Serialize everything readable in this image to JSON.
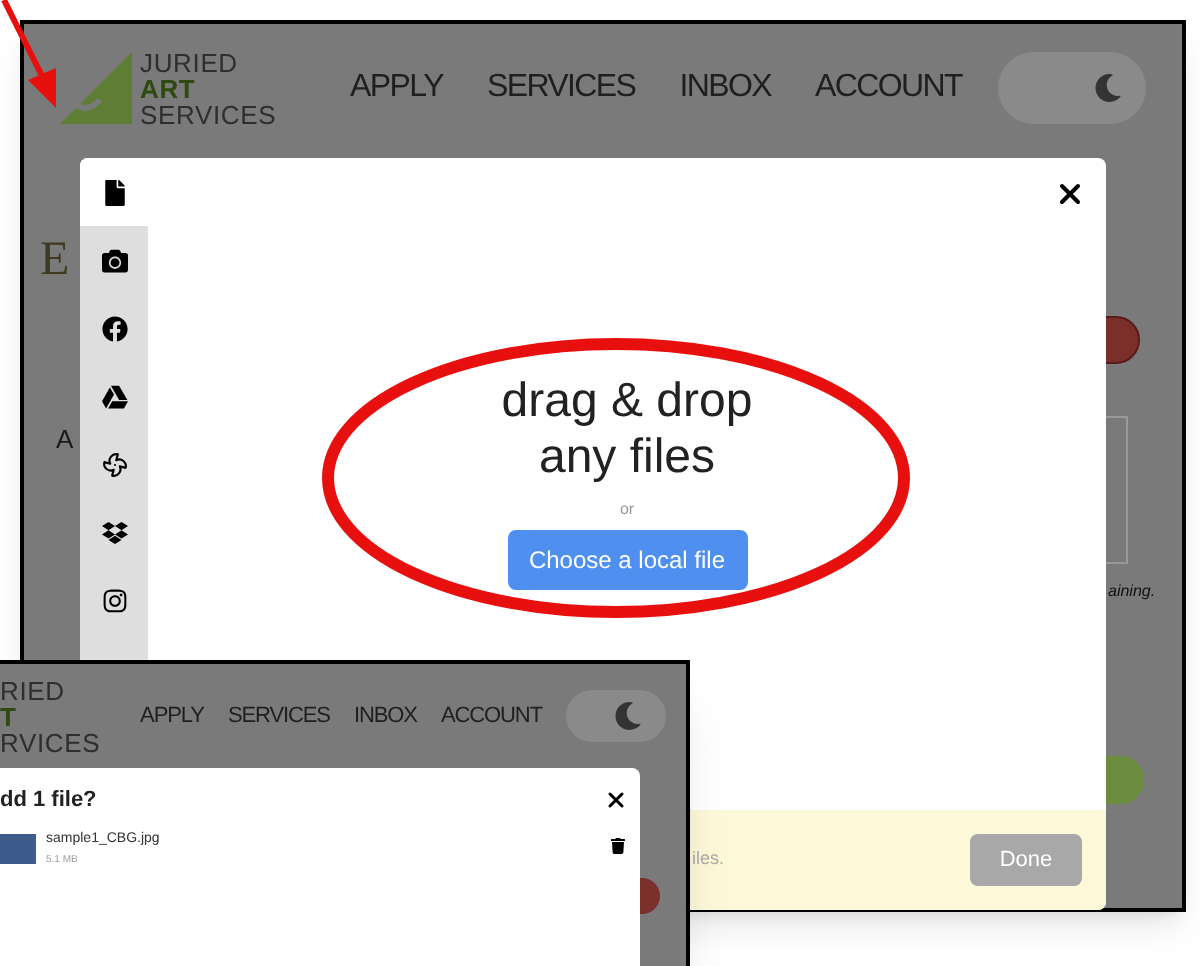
{
  "main_screen": {
    "header": {
      "logo_lines": [
        "JURIED",
        "ART",
        "SERVICES"
      ],
      "nav": [
        "APPLY",
        "SERVICES",
        "INBOX",
        "ACCOUNT"
      ],
      "dark_mode_toggle": {
        "on": true
      }
    },
    "background_texts": [
      "E",
      "A",
      "aining."
    ],
    "upload_dialog": {
      "sources": [
        {
          "kind": "device",
          "selected": true
        },
        {
          "kind": "camera",
          "selected": false
        },
        {
          "kind": "facebook",
          "selected": false
        },
        {
          "kind": "drive",
          "selected": false
        },
        {
          "kind": "photos",
          "selected": false
        },
        {
          "kind": "dropbox",
          "selected": false
        },
        {
          "kind": "instagram",
          "selected": false
        }
      ],
      "drop_title": [
        "drag & drop",
        "any files"
      ],
      "separator": "or",
      "choose_button": "Choose a local file",
      "footer_text": "iles.",
      "done_button": {
        "label": "Done",
        "disabled": true
      }
    }
  },
  "inset_screen": {
    "header": {
      "logo_lines": [
        "RIED",
        "T",
        "RVICES"
      ],
      "nav": [
        "APPLY",
        "SERVICES",
        "INBOX",
        "ACCOUNT"
      ],
      "dark_mode_toggle": {
        "on": true
      }
    },
    "dialog": {
      "title": "dd 1 file?",
      "files": [
        {
          "name": "sample1_CBG.jpg",
          "size": "5.1 MB"
        }
      ]
    }
  }
}
